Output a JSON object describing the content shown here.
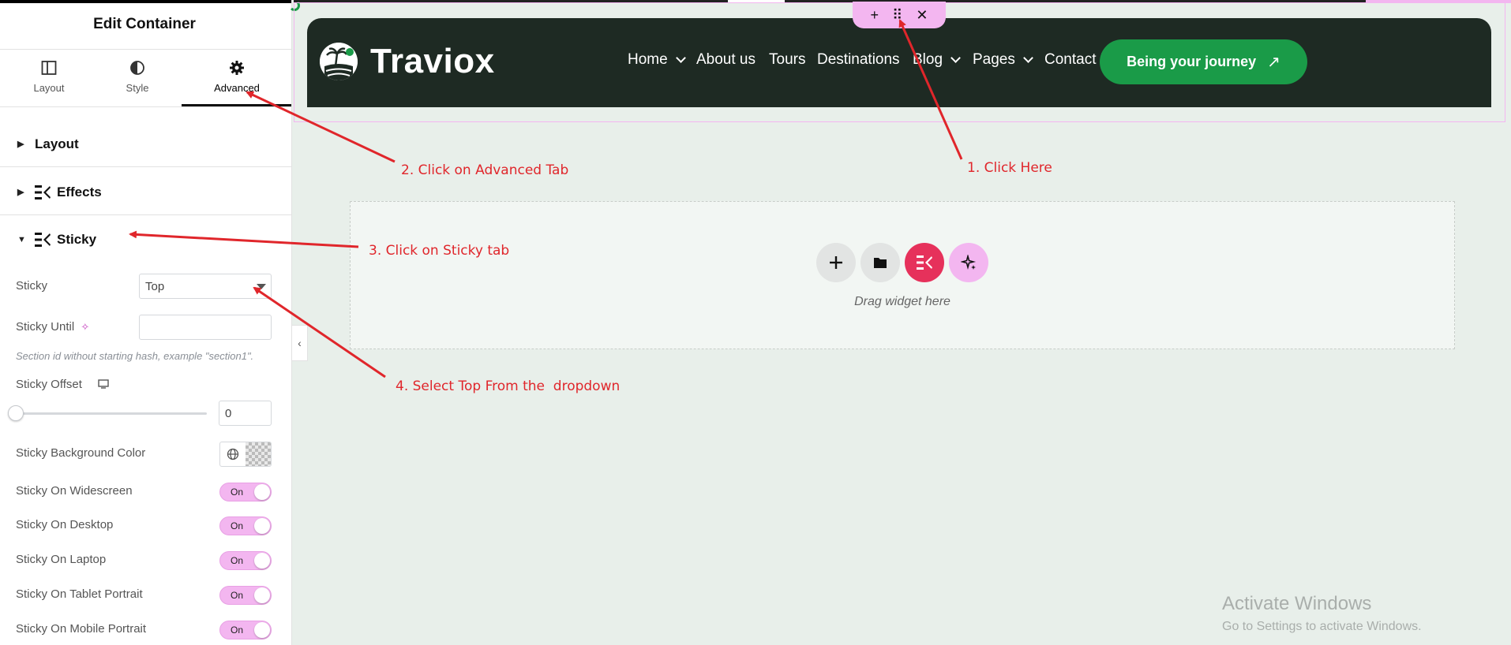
{
  "panel": {
    "title": "Edit Container",
    "tabs": [
      {
        "label": "Layout",
        "icon": "layout-icon"
      },
      {
        "label": "Style",
        "icon": "style-icon"
      },
      {
        "label": "Advanced",
        "icon": "gear-icon",
        "active": true
      }
    ],
    "sections": [
      {
        "label": "Layout",
        "expanded": false
      },
      {
        "label": "Effects",
        "expanded": false
      },
      {
        "label": "Sticky",
        "expanded": true
      }
    ],
    "sticky": {
      "sticky_label": "Sticky",
      "sticky_value": "Top",
      "until_label": "Sticky Until",
      "until_value": "",
      "until_hint": "Section id without starting hash, example \"section1\".",
      "offset_label": "Sticky Offset",
      "offset_value": "0",
      "bg_label": "Sticky Background Color",
      "toggles": [
        {
          "label": "Sticky On Widescreen",
          "state": "On"
        },
        {
          "label": "Sticky On Desktop",
          "state": "On"
        },
        {
          "label": "Sticky On Laptop",
          "state": "On"
        },
        {
          "label": "Sticky On Tablet Portrait",
          "state": "On"
        },
        {
          "label": "Sticky On Mobile Portrait",
          "state": "On"
        }
      ]
    }
  },
  "site": {
    "logo_text": "Traviox",
    "nav": [
      {
        "label": "Home",
        "dropdown": true
      },
      {
        "label": "About us",
        "dropdown": false
      },
      {
        "label": "Tours",
        "dropdown": false
      },
      {
        "label": "Destinations",
        "dropdown": false
      },
      {
        "label": "Blog",
        "dropdown": true
      },
      {
        "label": "Pages",
        "dropdown": true
      },
      {
        "label": "Contact Us",
        "dropdown": false
      }
    ],
    "cta": "Being your journey",
    "cta_icon": "↗"
  },
  "container_handle": {
    "add": "+",
    "move": "⠿",
    "close": "✕"
  },
  "drop_zone": {
    "text": "Drag widget here"
  },
  "annotations": [
    "1. Click Here",
    "2. Click on Advanced Tab",
    "3. Click on Sticky tab",
    "4. Select Top From the  dropdown"
  ],
  "watermark": {
    "title": "Activate Windows",
    "subtitle": "Go to Settings to activate Windows."
  },
  "colors": {
    "accent_pink": "#f3b6f0",
    "header_bg": "#1e2a23",
    "cta_green": "#1a9b48",
    "elementor_red": "#e6315b",
    "annotation_red": "#e0262b",
    "canvas_bg": "#e8efea"
  }
}
